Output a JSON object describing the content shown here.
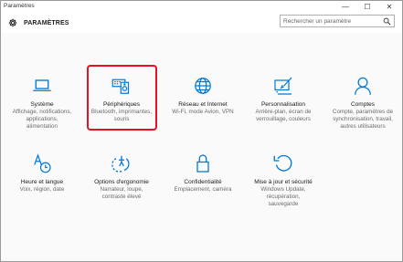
{
  "window": {
    "title": "Paramètres",
    "controls": {
      "minimize": "—",
      "maximize": "☐",
      "close": "✕"
    }
  },
  "header": {
    "app_name": "PARAMÈTRES",
    "icon": "gear-icon"
  },
  "search": {
    "placeholder": "Rechercher un paramètre",
    "value": "",
    "icon": "search-icon"
  },
  "accent_color": "#0078d7",
  "highlight_color": "#e81123",
  "categories": [
    {
      "name": "Système",
      "desc": [
        "Affichage, notifications,",
        "applications,",
        "alimentation"
      ],
      "icon": "laptop-icon"
    },
    {
      "name": "Périphériques",
      "desc": [
        "Bluetooth, imprimantes,",
        "souris"
      ],
      "icon": "devices-icon",
      "selected": true
    },
    {
      "name": "Réseau et Internet",
      "desc": [
        "Wi-Fi, mode Avion, VPN"
      ],
      "icon": "globe-icon"
    },
    {
      "name": "Personnalisation",
      "desc": [
        "Arrière-plan, écran de",
        "verrouillage, couleurs"
      ],
      "icon": "paintbrush-icon"
    },
    {
      "name": "Comptes",
      "desc": [
        "Compte, paramètres de",
        "synchronisation, travail,",
        "autres utilisateurs"
      ],
      "icon": "person-icon"
    },
    {
      "name": "Heure et langue",
      "desc": [
        "Voix, région, date"
      ],
      "icon": "time-language-icon"
    },
    {
      "name": "Options d'ergonomie",
      "desc": [
        "Narrateur, loupe,",
        "contraste élevé"
      ],
      "icon": "ease-of-access-icon"
    },
    {
      "name": "Confidentialité",
      "desc": [
        "Emplacement, caméra"
      ],
      "icon": "lock-icon"
    },
    {
      "name": "Mise à jour et sécurité",
      "desc": [
        "Windows Update,",
        "récupération,",
        "sauvegarde"
      ],
      "icon": "update-icon"
    }
  ]
}
